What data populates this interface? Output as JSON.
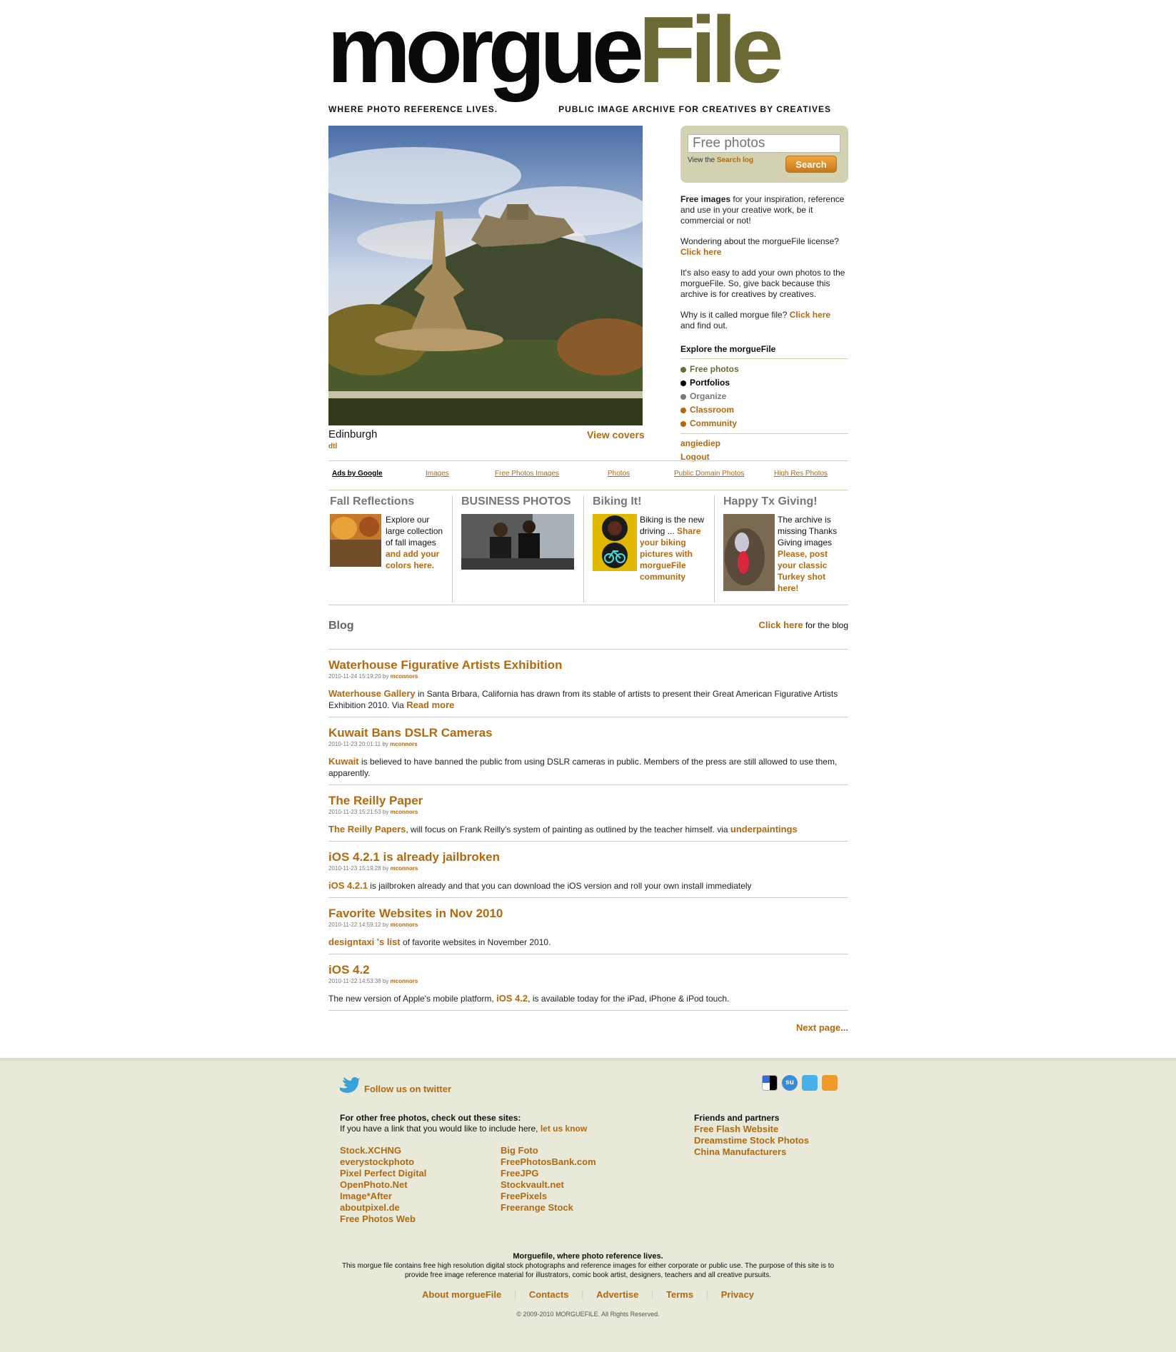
{
  "header": {
    "logo_part1": "morgue",
    "logo_part2": "File",
    "tagline_left": "WHERE PHOTO REFERENCE LIVES.",
    "tagline_right": "PUBLIC IMAGE ARCHIVE FOR CREATIVES BY CREATIVES"
  },
  "hero": {
    "caption": "Edinburgh",
    "author": "dtl",
    "view_covers": "View covers"
  },
  "search": {
    "placeholder": "Free photos",
    "log_prefix": "View the ",
    "log_link": "Search log",
    "button": "Search"
  },
  "side": {
    "intro_bold": "Free images",
    "intro_rest": " for your inspiration, reference and use in your creative work, be it commercial or not!",
    "license_q": "Wondering about the morgueFile license?",
    "license_link": "Click here",
    "add_photos": "It's also easy to add your own photos to the morgueFile. So, give back because this archive is for creatives by creatives.",
    "why_q": "Why is it called morgue file? ",
    "why_link": "Click here",
    "why_end": "and find out.",
    "explore_title": "Explore the morgueFile",
    "nav": [
      {
        "label": "Free photos",
        "color": "#6b6a35"
      },
      {
        "label": "Portfolios",
        "color": "#000000"
      },
      {
        "label": "Organize",
        "color": "#7a7a7a"
      },
      {
        "label": "Classroom",
        "color": "#b4690e"
      },
      {
        "label": "Community",
        "color": "#b4690e"
      }
    ],
    "user": "angiediep",
    "logout": "Logout"
  },
  "ads": {
    "label": "Ads by Google",
    "links": [
      "Images",
      "Free Photos Images",
      "Photos",
      "Public Domain Photos",
      "High Res Photos"
    ]
  },
  "features": [
    {
      "title": "Fall Reflections",
      "text": "Explore our large collection of fall images",
      "link": "and add your colors here."
    },
    {
      "title": "BUSINESS PHOTOS"
    },
    {
      "title": "Biking It!",
      "text": "Biking is the new driving ...",
      "link": "Share your biking pictures with morgueFile community"
    },
    {
      "title": "Happy Tx Giving!",
      "text": "The archive is missing Thanks Giving images",
      "link": "Please, post your classic Turkey shot here!"
    }
  ],
  "blog": {
    "title": "Blog",
    "click_here": "Click here",
    "for_blog": " for the blog",
    "posts": [
      {
        "title": "Waterhouse Figurative Artists Exhibition",
        "date": "2010-11-24 15:19:20 by ",
        "author": "mconnors",
        "link1": "Waterhouse Gallery",
        "text": " in Santa Brbara, California has drawn from its stable of artists to present their Great American Figurative Artists Exhibition 2010. Via ",
        "link2": "Read more"
      },
      {
        "title": "Kuwait Bans DSLR Cameras",
        "date": "2010-11-23 20:01:11 by ",
        "author": "mconnors",
        "link1": "Kuwait",
        "text": " is believed to have banned the public from using DSLR cameras in public. Members of the press are still allowed to use them, apparently.",
        "link2": ""
      },
      {
        "title": "The Reilly Paper",
        "date": "2010-11-23 15:21:53 by ",
        "author": "mconnors",
        "link1": "The Reilly Papers",
        "text": ", will focus on Frank Reilly's system of painting as outlined by the teacher himself. via ",
        "link2": "underpaintings"
      },
      {
        "title": "iOS 4.2.1 is already jailbroken",
        "date": "2010-11-23 15:19:28 by ",
        "author": "mconnors",
        "link1": "iOS 4.2.1",
        "text": " is jailbroken already and that you can download the iOS version and roll your own install immediately",
        "link2": ""
      },
      {
        "title": "Favorite Websites in Nov 2010",
        "date": "2010-11-22 14:59:12 by ",
        "author": "mconnors",
        "link1": "designtaxi 's list",
        "text": " of favorite websites in November 2010.",
        "link2": ""
      },
      {
        "title": "iOS 4.2",
        "date": "2010-11-22 14:53:38 by ",
        "author": "mconnors",
        "pre": "The new version of Apple's mobile platform, ",
        "link1": "iOS 4.2",
        "text": ", is available today for the iPad, iPhone & iPod touch.",
        "link2": ""
      }
    ],
    "next": "Next page..."
  },
  "footer": {
    "twitter": "Follow us on twitter",
    "other_title": "For other free photos, check out these sites:",
    "other_sub": "If you have a link that you would like to include here, ",
    "let_us_know": "let us know",
    "sites_col1": [
      "Stock.XCHNG",
      "everystockphoto",
      "Pixel Perfect Digital",
      "OpenPhoto.Net",
      "Image*After",
      "aboutpixel.de",
      "Free Photos Web"
    ],
    "sites_col2": [
      "Big Foto",
      "FreePhotosBank.com",
      "FreeJPG",
      "Stockvault.net",
      "FreePixels",
      "Freerange Stock"
    ],
    "friends_title": "Friends and partners",
    "friends": [
      "Free Flash Website",
      "Dreamstime Stock Photos",
      "China Manufacturers"
    ],
    "about_title": "Morguefile, where photo reference lives.",
    "about_text": "This morgue file contains free high resolution digital stock photographs and reference images for either corporate or public use. The purpose of this site is to provide free image reference material for illustrators, comic book artist, designers, teachers and all creative pursuits.",
    "links": [
      "About morgueFile",
      "Contacts",
      "Advertise",
      "Terms",
      "Privacy"
    ],
    "copyright": "© 2009-2010 MORGUEFILE. All Rights Reserved.",
    "social_icons": [
      "delicious-icon",
      "stumbleupon-icon",
      "twitter-icon",
      "rss-icon"
    ]
  }
}
